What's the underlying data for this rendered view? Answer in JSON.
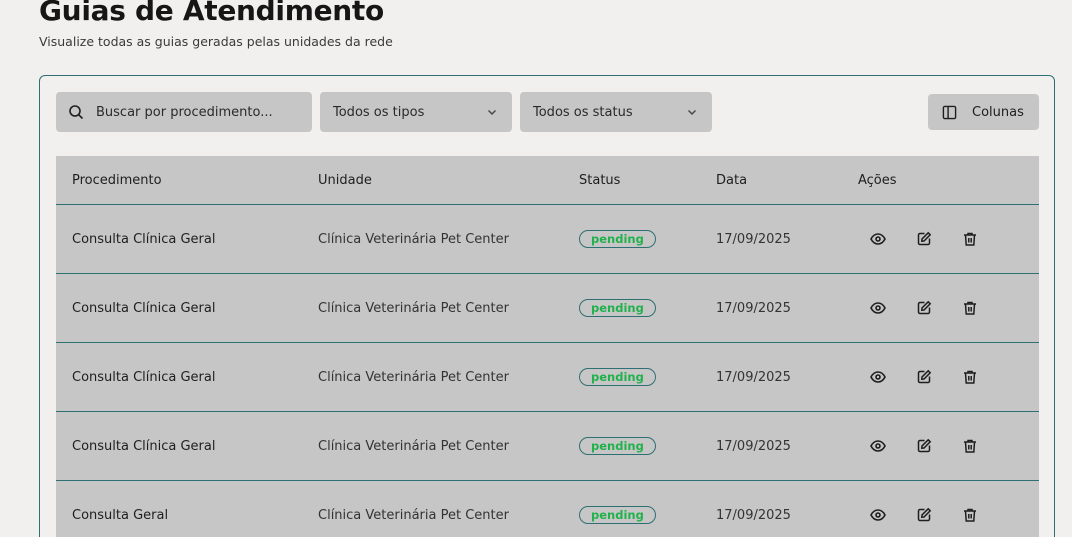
{
  "header": {
    "title": "Guias de Atendimento",
    "subtitle": "Visualize todas as guias geradas pelas unidades da rede"
  },
  "toolbar": {
    "search_placeholder": "Buscar por procedimento...",
    "type_filter": "Todos os tipos",
    "status_filter": "Todos os status",
    "columns_button": "Colunas"
  },
  "table": {
    "headers": {
      "procedimento": "Procedimento",
      "unidade": "Unidade",
      "status": "Status",
      "data": "Data",
      "acoes": "Ações"
    },
    "rows": [
      {
        "procedimento": "Consulta Clínica Geral",
        "unidade": "Clínica Veterinária Pet Center",
        "status": "pending",
        "data": "17/09/2025"
      },
      {
        "procedimento": "Consulta Clínica Geral",
        "unidade": "Clínica Veterinária Pet Center",
        "status": "pending",
        "data": "17/09/2025"
      },
      {
        "procedimento": "Consulta Clínica Geral",
        "unidade": "Clínica Veterinária Pet Center",
        "status": "pending",
        "data": "17/09/2025"
      },
      {
        "procedimento": "Consulta Clínica Geral",
        "unidade": "Clínica Veterinária Pet Center",
        "status": "pending",
        "data": "17/09/2025"
      },
      {
        "procedimento": "Consulta Geral",
        "unidade": "Clínica Veterinária Pet Center",
        "status": "pending",
        "data": "17/09/2025"
      }
    ],
    "row_actions": [
      "eye-icon",
      "edit-icon",
      "trash-icon"
    ]
  },
  "colors": {
    "accent": "#2e6f73",
    "status_pending": "#22b14c",
    "surface": "#c6c6c6",
    "background": "#f1f0ee"
  }
}
